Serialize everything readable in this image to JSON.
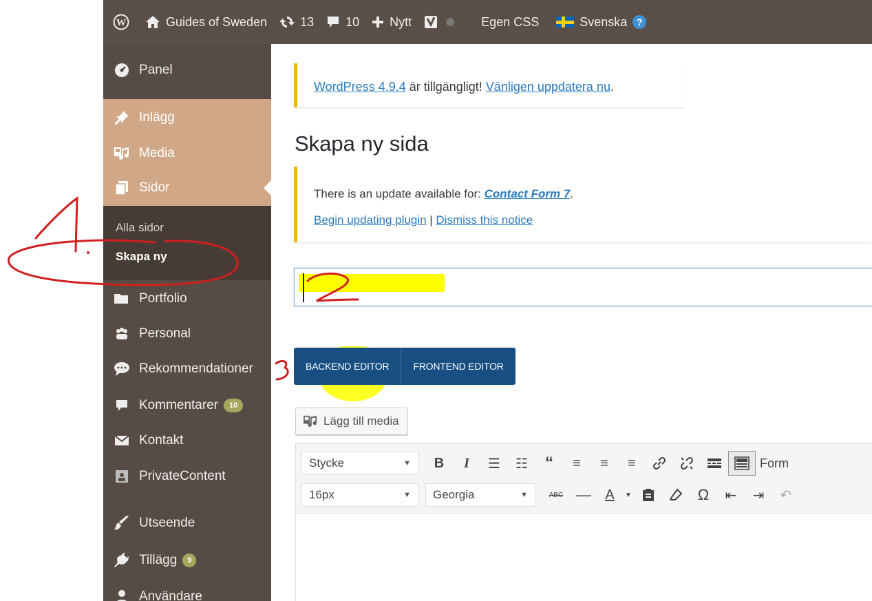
{
  "adminbar": {
    "site_name": "Guides of Sweden",
    "updates_count": "13",
    "comments_count": "10",
    "new_label": "Nytt",
    "custom_css_label": "Egen CSS",
    "language_label": "Svenska",
    "help_glyph": "?"
  },
  "sidebar": {
    "panel": "Panel",
    "posts": "Inlägg",
    "media": "Media",
    "pages": "Sidor",
    "sub_all_pages": "Alla sidor",
    "sub_add_new": "Skapa ny",
    "portfolio": "Portfolio",
    "personal": "Personal",
    "recommendations": "Rekommendationer",
    "comments": "Kommentarer",
    "comments_badge": "10",
    "contact": "Kontakt",
    "private_content": "PrivateContent",
    "appearance": "Utseende",
    "plugins": "Tillägg",
    "plugins_badge": "9",
    "users": "Användare"
  },
  "notices": {
    "wp_update_link": "WordPress 4.9.4",
    "wp_update_text": " är tillgängligt! ",
    "wp_update_action": "Vänligen uppdatera nu",
    "wp_update_end": ".",
    "plugin_text": "There is an update available for: ",
    "plugin_name": "Contact Form 7",
    "plugin_end": ".",
    "begin_updating": "Begin updating plugin",
    "separator": " | ",
    "dismiss": "Dismiss this notice"
  },
  "page": {
    "title": "Skapa ny sida"
  },
  "editor": {
    "backend_label": "BACKEND EDITOR",
    "frontend_label": "FRONTEND EDITOR",
    "add_media_label": "Lägg till media",
    "format_select": "Stycke",
    "size_select": "16px",
    "font_select": "Georgia",
    "format_cut_label": "Form"
  },
  "annotations": {
    "step1": "1.",
    "step2": "2",
    "step3": "3"
  },
  "colors": {
    "adminbar_bg": "#5a4f48",
    "sidebar_bg": "#574c45",
    "sidebar_active_group": "#d1a887",
    "submenu_bg": "#463b35",
    "notice_border": "#f0b70d",
    "editor_switch_bg": "#184f82",
    "annotation_red": "#d01f1f",
    "highlight_yellow": "#ffff00"
  }
}
